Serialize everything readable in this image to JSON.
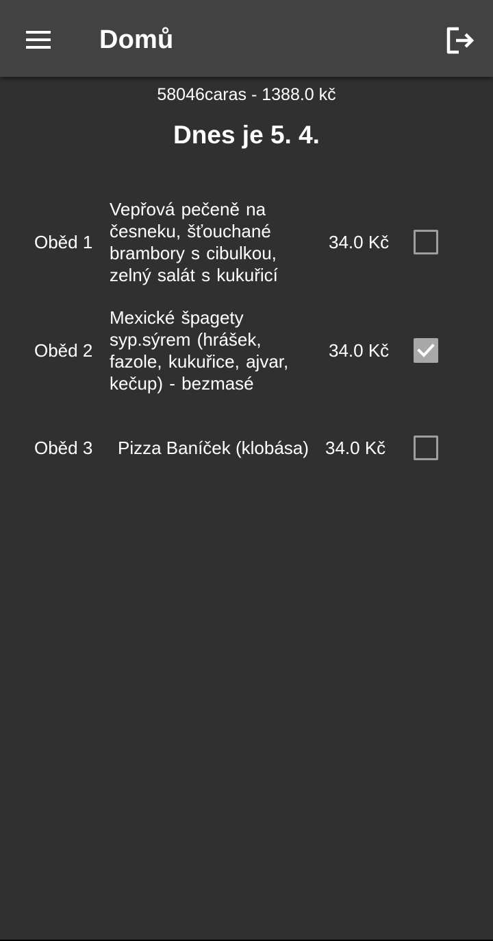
{
  "appbar": {
    "title": "Domů",
    "menu_icon": "menu-icon",
    "logout_icon": "logout-icon"
  },
  "account": {
    "summary": "58046caras - 1388.0 kč"
  },
  "date_heading": "Dnes je 5. 4.",
  "meals": [
    {
      "label": "Oběd 1",
      "name": "Vepřová pečeně na česneku,  šťouchané brambory s cibulkou, zelný salát s kukuřicí",
      "price": "34.0 Kč",
      "selected": false
    },
    {
      "label": "Oběd 2",
      "name": "Mexické špagety syp.sýrem (hrášek, fazole,  kukuřice,  ajvar, kečup) - bezmasé",
      "price": "34.0 Kč",
      "selected": true
    },
    {
      "label": "Oběd 3",
      "name": "Pizza Baníček (klobása)",
      "price": "34.0 Kč",
      "selected": false
    }
  ],
  "colors": {
    "background": "#303030",
    "appbar": "#424242",
    "checkbox_border": "#9e9e9e",
    "checkbox_checked": "#a8a8a8"
  }
}
